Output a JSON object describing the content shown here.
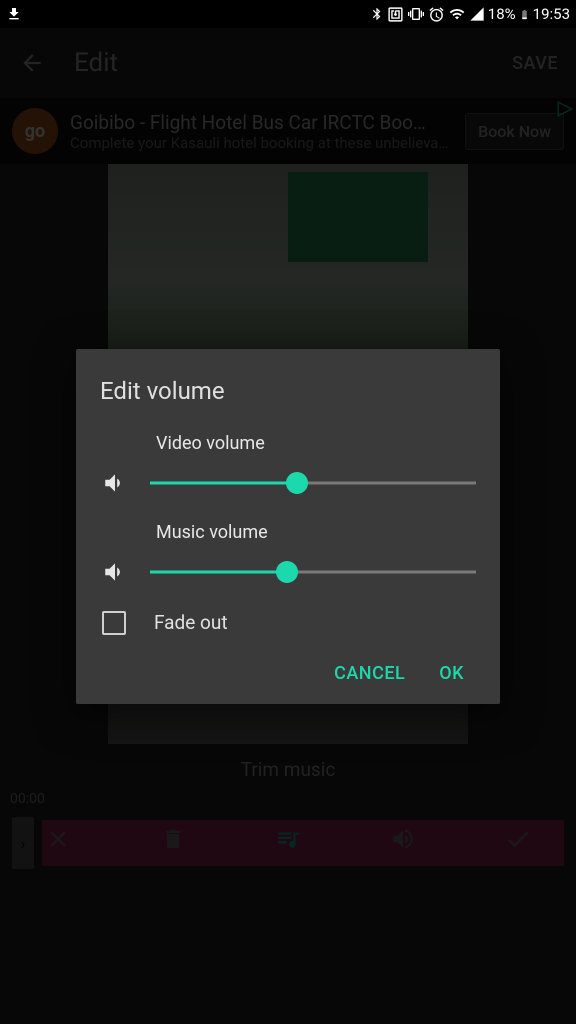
{
  "status": {
    "battery": "18%",
    "time": "19:53"
  },
  "appbar": {
    "title": "Edit",
    "save": "SAVE"
  },
  "ad": {
    "brand": "go",
    "title": "Goibibo - Flight Hotel Bus Car IRCTC Boo…",
    "subtitle": "Complete your Kasauli hotel booking at these unbelievable …",
    "cta": "Book Now"
  },
  "trim": {
    "label": "Trim music",
    "timecode": "00:00"
  },
  "dialog": {
    "title": "Edit volume",
    "video_label": "Video volume",
    "video_pct": 45,
    "music_label": "Music volume",
    "music_pct": 42,
    "fade_label": "Fade out",
    "fade_checked": false,
    "cancel": "CANCEL",
    "ok": "OK"
  },
  "colors": {
    "accent": "#1cd9ad",
    "trackbar": "#a1285a"
  }
}
